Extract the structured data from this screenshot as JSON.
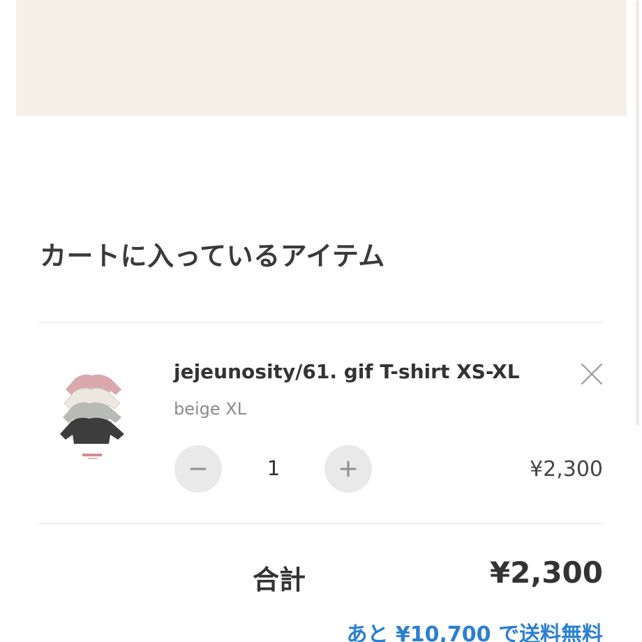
{
  "cart": {
    "title": "カートに入っているアイテム",
    "items": [
      {
        "name": "jejeunosity/61. gif T-shirt XS-XL",
        "variant": "beige XL",
        "quantity": "1",
        "price": "¥2,300"
      }
    ],
    "total_label": "合計",
    "total_price": "¥2,300",
    "shipping_note": "あと ¥10,700 で送料無料"
  },
  "icons": {
    "remove": "close-icon",
    "decrease": "minus-icon",
    "increase": "plus-icon"
  },
  "colors": {
    "banner_bg": "#f5efe7",
    "accent_blue": "#2b7fd1",
    "qty_button_bg": "#e9e9e9",
    "divider": "#e4e4e4"
  }
}
